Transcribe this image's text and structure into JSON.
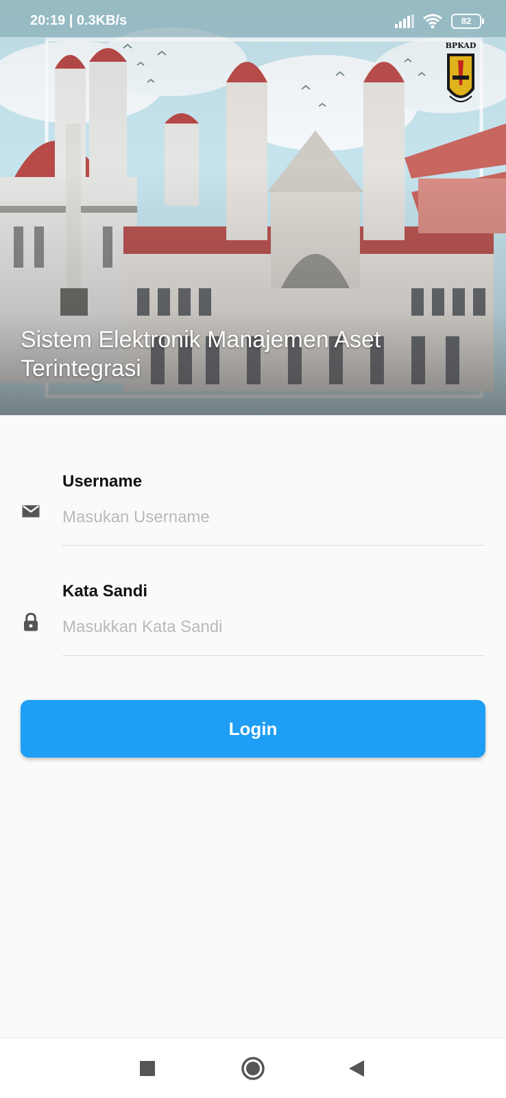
{
  "status_bar": {
    "time_speed": "20:19 | 0.3KB/s",
    "battery_level": "82"
  },
  "header": {
    "title": "Sistem Elektronik Manajemen Aset Terintegrasi",
    "logo_text": "BPKAD"
  },
  "form": {
    "username": {
      "label": "Username",
      "placeholder": "Masukan Username",
      "value": ""
    },
    "password": {
      "label": "Kata Sandi",
      "placeholder": "Masukkan Kata Sandi",
      "value": ""
    },
    "login_label": "Login"
  },
  "icons": {
    "username": "mail-icon",
    "password": "lock-icon",
    "nav_recents": "square-icon",
    "nav_home": "circle-icon",
    "nav_back": "triangle-back-icon"
  },
  "colors": {
    "accent": "#1e9ef4",
    "background": "#fafafa",
    "placeholder": "#b9b9bd"
  }
}
